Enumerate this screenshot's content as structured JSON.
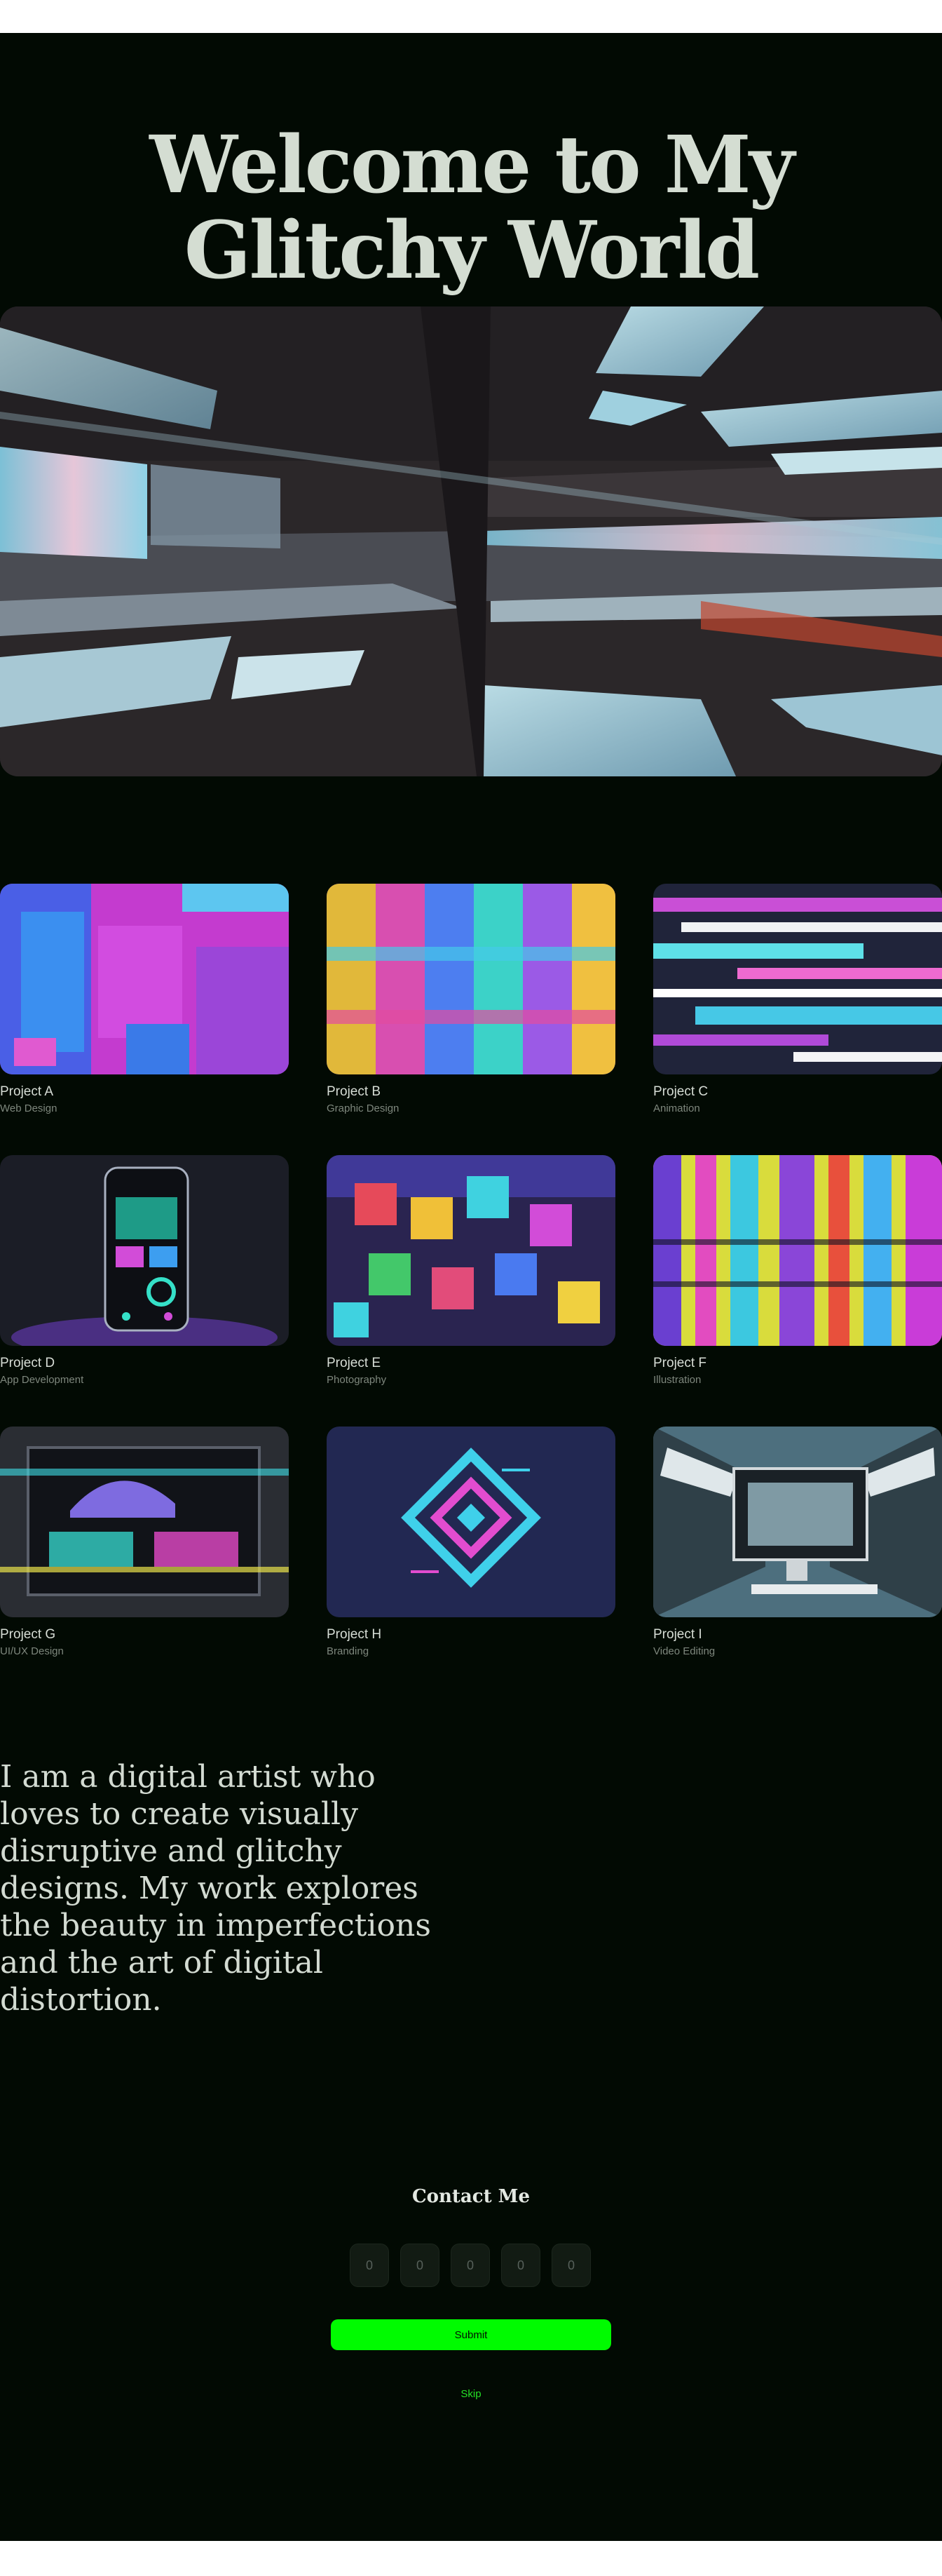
{
  "hero": {
    "title": "Welcome to My Glitchy World",
    "image_icon": "glitch-corridor-image"
  },
  "projects": [
    {
      "name": "Project A",
      "category": "Web Design"
    },
    {
      "name": "Project B",
      "category": "Graphic Design"
    },
    {
      "name": "Project C",
      "category": "Animation"
    },
    {
      "name": "Project D",
      "category": "App Development"
    },
    {
      "name": "Project E",
      "category": "Photography"
    },
    {
      "name": "Project F",
      "category": "Illustration"
    },
    {
      "name": "Project G",
      "category": "UI/UX Design"
    },
    {
      "name": "Project H",
      "category": "Branding"
    },
    {
      "name": "Project I",
      "category": "Video Editing"
    }
  ],
  "about": {
    "text": "I am a digital artist who loves to create visually disruptive and glitchy designs. My work explores the beauty in imperfections and the art of digital distortion."
  },
  "contact": {
    "title": "Contact Me",
    "code_digits": [
      "0",
      "0",
      "0",
      "0",
      "0"
    ],
    "submit_label": "Submit",
    "skip_label": "Skip"
  },
  "colors": {
    "background": "#020a03",
    "accent": "#00fb00",
    "text": "#d4ddd2",
    "muted": "#7e877d"
  }
}
